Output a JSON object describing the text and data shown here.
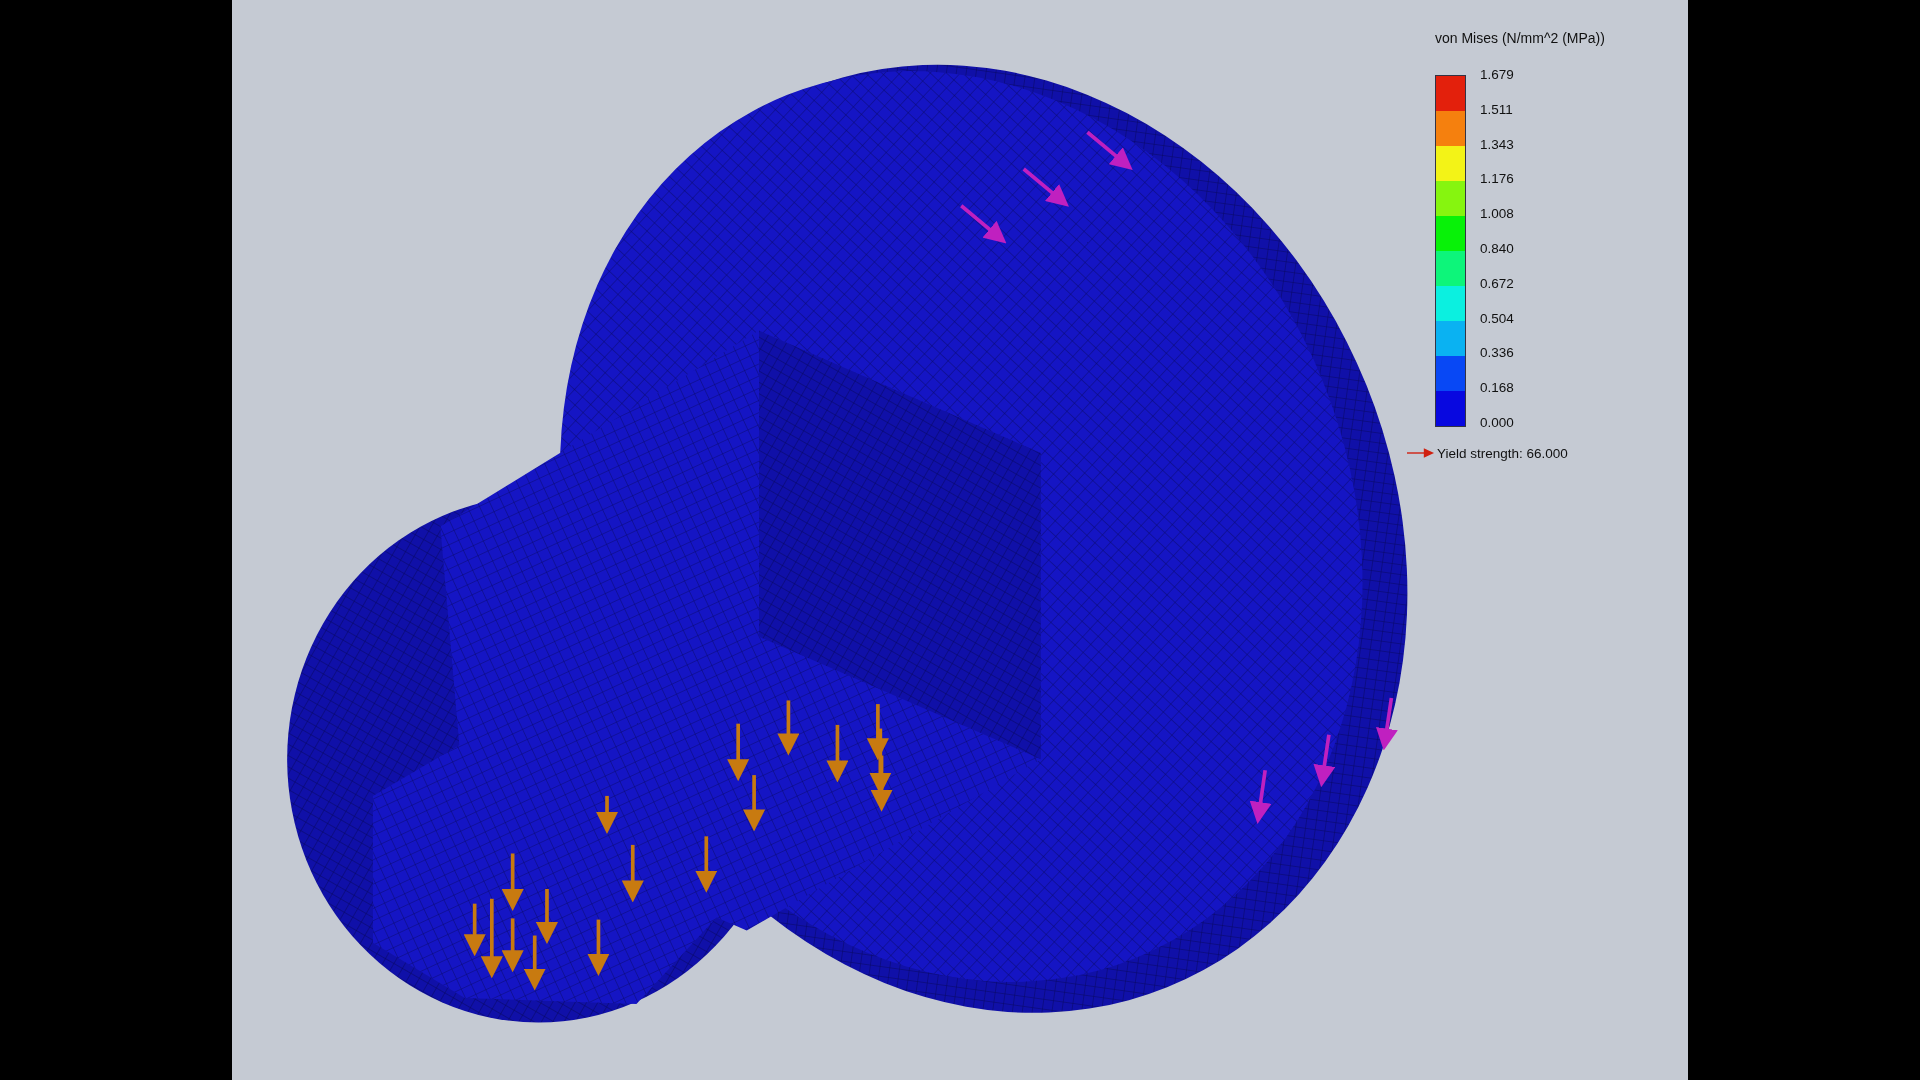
{
  "legend": {
    "title": "von Mises (N/mm^2 (MPa))",
    "ticks": [
      "1.679",
      "1.511",
      "1.343",
      "1.176",
      "1.008",
      "0.840",
      "0.672",
      "0.504",
      "0.336",
      "0.168",
      "0.000"
    ],
    "bands": [
      {
        "color": "#e3200c"
      },
      {
        "color": "#f5800e"
      },
      {
        "color": "#f3f317"
      },
      {
        "color": "#86f50f"
      },
      {
        "color": "#08f208"
      },
      {
        "color": "#0df57a"
      },
      {
        "color": "#0bf0e0"
      },
      {
        "color": "#0ab2f2"
      },
      {
        "color": "#0848f5"
      },
      {
        "color": "#0808e0"
      }
    ],
    "yield_marker": "Yield strength: 66.000"
  }
}
